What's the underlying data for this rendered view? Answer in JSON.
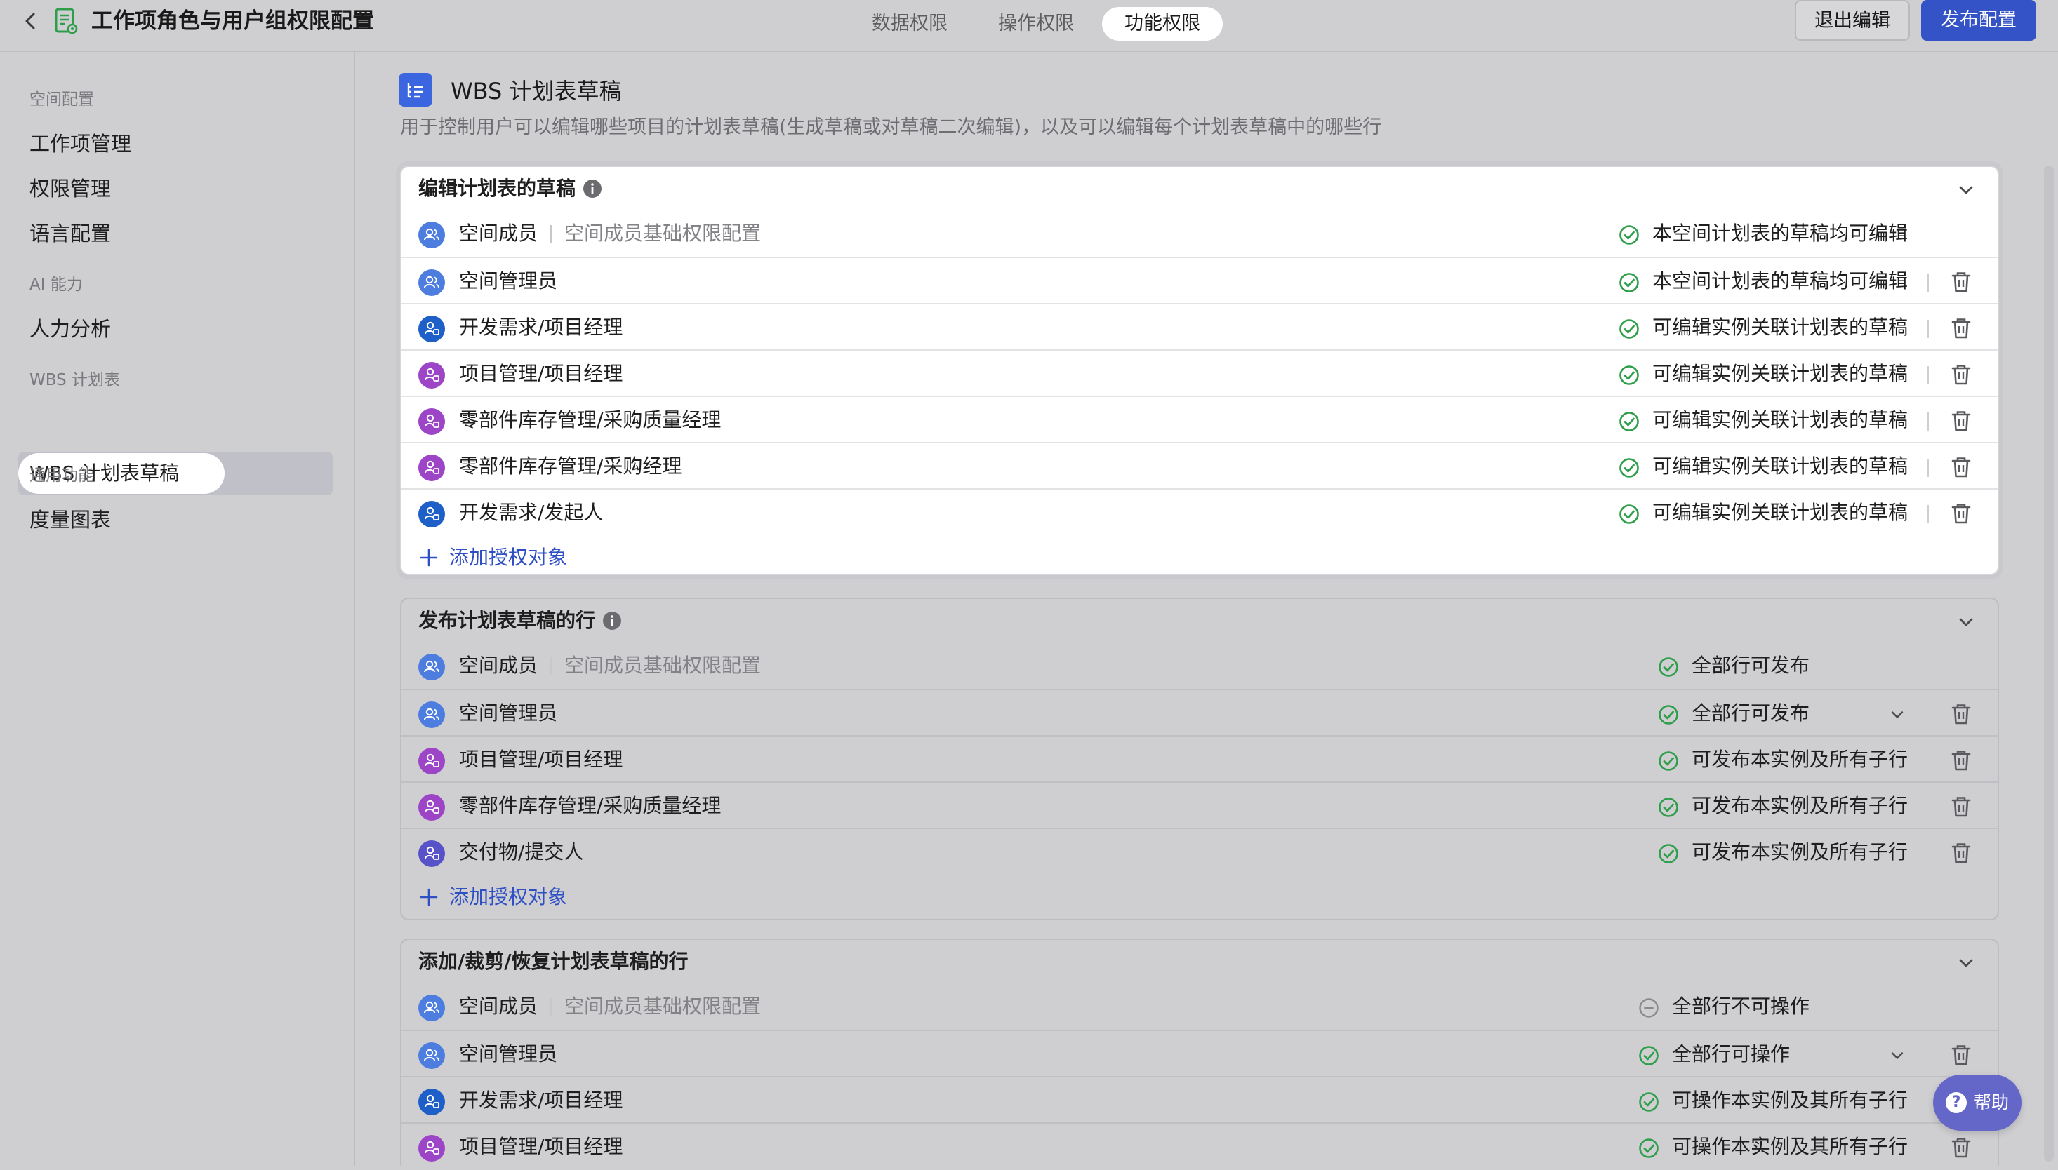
{
  "header": {
    "title": "工作项角色与用户组权限配置",
    "tabs": [
      {
        "label": "数据权限",
        "active": false
      },
      {
        "label": "操作权限",
        "active": false
      },
      {
        "label": "功能权限",
        "active": true
      }
    ],
    "exit_label": "退出编辑",
    "publish_label": "发布配置"
  },
  "sidebar": {
    "groups": [
      {
        "label": "空间配置",
        "items": [
          "工作项管理",
          "权限管理",
          "语言配置"
        ]
      },
      {
        "label": "AI 能力",
        "items": [
          "人力分析"
        ]
      },
      {
        "label": "WBS 计划表",
        "items": [
          "WBS 计划表草稿"
        ]
      },
      {
        "label": "通用功能",
        "items": [
          "度量图表"
        ]
      }
    ],
    "active_item": "WBS 计划表草稿"
  },
  "section": {
    "title": "WBS 计划表草稿",
    "description": "用于控制用户可以编辑哪些项目的计划表草稿(生成草稿或对草稿二次编辑)，以及可以编辑每个计划表草稿中的哪些行"
  },
  "cards": [
    {
      "title": "编辑计划表的草稿",
      "rows": [
        {
          "name": "空间成员",
          "sub": "空间成员基础权限配置",
          "perm": "本空间计划表的草稿均可编辑"
        },
        {
          "name": "空间管理员",
          "perm": "本空间计划表的草稿均可编辑"
        },
        {
          "name": "开发需求/项目经理",
          "perm": "可编辑实例关联计划表的草稿"
        },
        {
          "name": "项目管理/项目经理",
          "perm": "可编辑实例关联计划表的草稿"
        },
        {
          "name": "零部件库存管理/采购质量经理",
          "perm": "可编辑实例关联计划表的草稿"
        },
        {
          "name": "零部件库存管理/采购经理",
          "perm": "可编辑实例关联计划表的草稿"
        },
        {
          "name": "开发需求/发起人",
          "perm": "可编辑实例关联计划表的草稿"
        }
      ],
      "add_label": "添加授权对象"
    },
    {
      "title": "发布计划表草稿的行",
      "rows": [
        {
          "name": "空间成员",
          "sub": "空间成员基础权限配置",
          "perm": "全部行可发布"
        },
        {
          "name": "空间管理员",
          "perm": "全部行可发布"
        },
        {
          "name": "项目管理/项目经理",
          "perm": "可发布本实例及所有子行"
        },
        {
          "name": "零部件库存管理/采购质量经理",
          "perm": "可发布本实例及所有子行"
        },
        {
          "name": "交付物/提交人",
          "perm": "可发布本实例及所有子行"
        }
      ],
      "add_label": "添加授权对象"
    },
    {
      "title": "添加/裁剪/恢复计划表草稿的行",
      "rows": [
        {
          "name": "空间成员",
          "sub": "空间成员基础权限配置",
          "perm": "全部行不可操作"
        },
        {
          "name": "空间管理员",
          "perm": "全部行可操作"
        },
        {
          "name": "开发需求/项目经理",
          "perm": "可操作本实例及其所有子行"
        },
        {
          "name": "项目管理/项目经理",
          "perm": "可操作本实例及其所有子行"
        }
      ]
    }
  ],
  "help_label": "帮助",
  "colors": {
    "accent": "#3353c6",
    "success": "#2e9e4a",
    "avatar_blue": "#4e7de0",
    "avatar_darkblue": "#1e5fc8",
    "avatar_purple": "#9d45c7",
    "avatar_indigo": "#5852c9"
  }
}
